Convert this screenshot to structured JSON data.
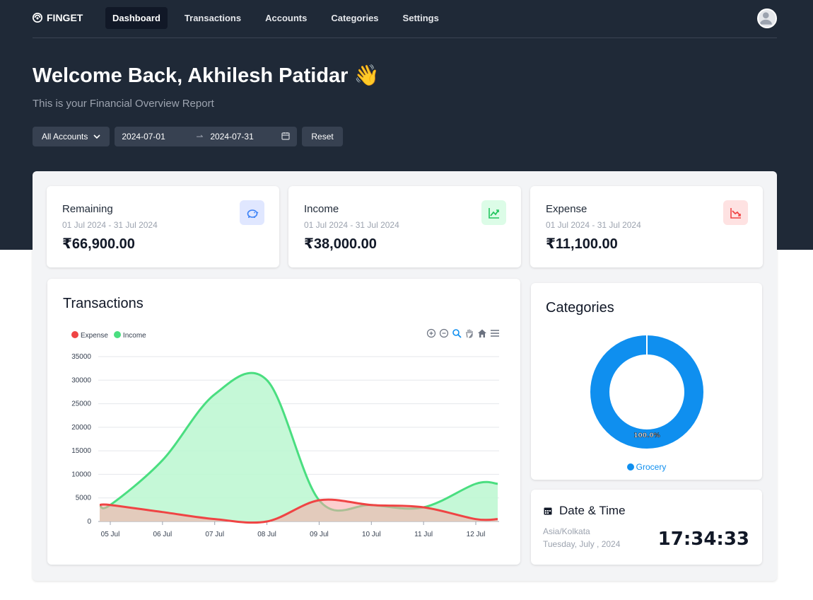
{
  "app": {
    "brand": "FINGET"
  },
  "nav": {
    "items": [
      {
        "label": "Dashboard",
        "active": true
      },
      {
        "label": "Transactions"
      },
      {
        "label": "Accounts"
      },
      {
        "label": "Categories"
      },
      {
        "label": "Settings"
      }
    ]
  },
  "hero": {
    "welcome": "Welcome Back, Akhilesh Patidar 👋",
    "subtitle": "This is your Financial Overview Report"
  },
  "filters": {
    "account": "All Accounts",
    "start_date": "2024-07-01",
    "end_date": "2024-07-31",
    "reset": "Reset"
  },
  "stats": [
    {
      "title": "Remaining",
      "range": "01 Jul 2024 - 31 Jul 2024",
      "value": "₹66,900.00",
      "icon": "piggy-bank-icon",
      "color": "#3b82f6"
    },
    {
      "title": "Income",
      "range": "01 Jul 2024 - 31 Jul 2024",
      "value": "₹38,000.00",
      "icon": "trending-up-icon",
      "color": "#22c55e"
    },
    {
      "title": "Expense",
      "range": "01 Jul 2024 - 31 Jul 2024",
      "value": "₹11,100.00",
      "icon": "trending-down-icon",
      "color": "#ef4444"
    }
  ],
  "transactions": {
    "title": "Transactions",
    "chart_data": {
      "type": "area",
      "x": [
        "05 Jul",
        "06 Jul",
        "07 Jul",
        "08 Jul",
        "09 Jul",
        "10 Jul",
        "11 Jul",
        "12 Jul"
      ],
      "series": [
        {
          "name": "Expense",
          "color": "#ef4444",
          "values": [
            3500,
            2000,
            500,
            0,
            4500,
            3500,
            3000,
            500
          ]
        },
        {
          "name": "Income",
          "color": "#4ade80",
          "values": [
            3500,
            13000,
            27000,
            30000,
            4500,
            3500,
            3000,
            8000
          ]
        }
      ],
      "y_ticks": [
        0,
        5000,
        10000,
        15000,
        20000,
        25000,
        30000,
        35000
      ],
      "ylim": [
        0,
        35000
      ],
      "grid": true,
      "legend": "top-left"
    }
  },
  "categories": {
    "title": "Categories",
    "chart_data": {
      "type": "pie",
      "categories": [
        "Grocery"
      ],
      "values": [
        100
      ],
      "label": "100.0%",
      "color": "#0f8fef"
    }
  },
  "datetime": {
    "title": "Date & Time",
    "timezone": "Asia/Kolkata",
    "date": "Tuesday, July , 2024",
    "time": "17:34:33"
  }
}
